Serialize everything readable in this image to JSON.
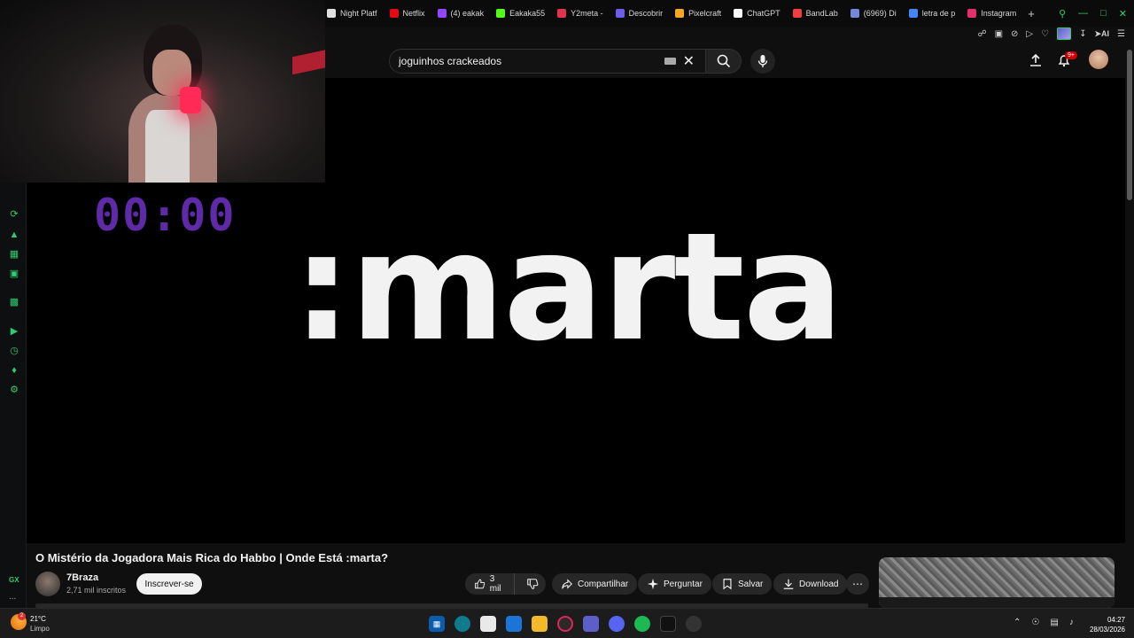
{
  "browser": {
    "tabs": [
      {
        "label": "Night Platf",
        "color": "#e0e0e0"
      },
      {
        "label": "Netflix",
        "color": "#e50914"
      },
      {
        "label": "(4) eakak",
        "color": "#9146ff"
      },
      {
        "label": "Eakaka55",
        "color": "#53fc18"
      },
      {
        "label": "Y2meta -",
        "color": "#e0344a"
      },
      {
        "label": "Descobrir",
        "color": "#6c5ce7"
      },
      {
        "label": "Pixelcraft",
        "color": "#f5a623"
      },
      {
        "label": "ChatGPT",
        "color": "#ffffff"
      },
      {
        "label": "BandLab",
        "color": "#f03e3e"
      },
      {
        "label": "(6969) Di",
        "color": "#7289da"
      },
      {
        "label": "letra de p",
        "color": "#4285f4"
      },
      {
        "label": "Instagram",
        "color": "#e1306c"
      }
    ],
    "new_tab": "+",
    "ai_label": "AI"
  },
  "gx_sidebar": {
    "label": "GX",
    "more": "..."
  },
  "youtube": {
    "search": {
      "value": "joguinhos crackeados"
    },
    "notifications_badge": "9+",
    "video": {
      "overlay_text": ":marta",
      "title": "O Mistério da Jogadora Mais Rica do Habbo | Onde Está :marta?",
      "channel": "7Braza",
      "subscribers": "2,71 mil inscritos",
      "subscribe_label": "Inscrever-se",
      "likes": "3 mil",
      "share_label": "Compartilhar",
      "ask_label": "Perguntar",
      "save_label": "Salvar",
      "download_label": "Download"
    }
  },
  "stream_overlay": {
    "timer": "00:00"
  },
  "taskbar": {
    "weather_badge": "2",
    "temperature": "21°C",
    "condition": "Limpo",
    "time": "04:27",
    "date": "28/03/2026"
  },
  "colors": {
    "gx_accent": "#2ecc71",
    "timer": "#5f2aa8",
    "youtube_bg": "#0f0f0f"
  }
}
